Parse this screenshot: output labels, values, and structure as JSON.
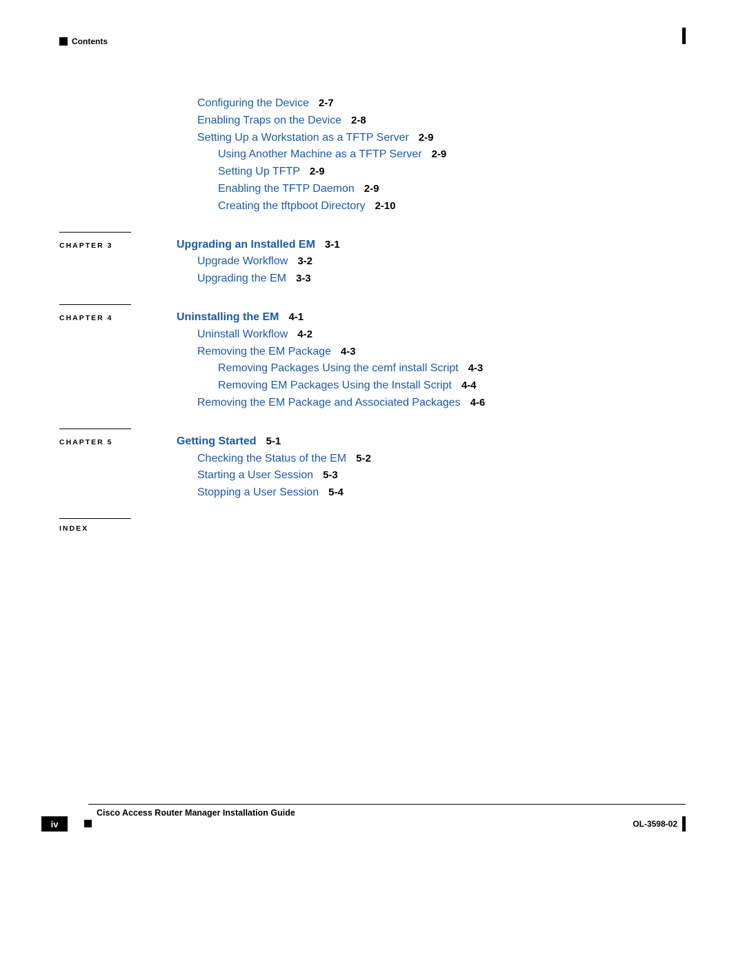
{
  "header": {
    "contents": "Contents"
  },
  "toc": {
    "preitems": [
      {
        "text": "Configuring the Device",
        "page": "2-7",
        "level": 1
      },
      {
        "text": "Enabling Traps on the Device",
        "page": "2-8",
        "level": 1
      },
      {
        "text": "Setting Up a Workstation as a TFTP Server",
        "page": "2-9",
        "level": 1
      },
      {
        "text": "Using Another Machine as a TFTP Server",
        "page": "2-9",
        "level": 2
      },
      {
        "text": "Setting Up TFTP",
        "page": "2-9",
        "level": 2
      },
      {
        "text": "Enabling the TFTP Daemon",
        "page": "2-9",
        "level": 2
      },
      {
        "text": "Creating the tftpboot Directory",
        "page": "2-10",
        "level": 2
      }
    ],
    "ch3": {
      "label": "CHAPTER 3",
      "title": "Upgrading an Installed EM",
      "title_page": "3-1",
      "items": [
        {
          "text": "Upgrade Workflow",
          "page": "3-2",
          "level": 1
        },
        {
          "text": "Upgrading the EM",
          "page": "3-3",
          "level": 1
        }
      ]
    },
    "ch4": {
      "label": "CHAPTER 4",
      "title": "Uninstalling the EM",
      "title_page": "4-1",
      "items": [
        {
          "text": "Uninstall Workflow",
          "page": "4-2",
          "level": 1
        },
        {
          "text": "Removing the EM Package",
          "page": "4-3",
          "level": 1
        },
        {
          "text": "Removing Packages Using the cemf install Script",
          "page": "4-3",
          "level": 2
        },
        {
          "text": "Removing EM Packages Using the Install Script",
          "page": "4-4",
          "level": 2
        },
        {
          "text": "Removing the EM Package and Associated Packages",
          "page": "4-6",
          "level": 1
        }
      ]
    },
    "ch5": {
      "label": "CHAPTER 5",
      "title": "Getting Started",
      "title_page": "5-1",
      "items": [
        {
          "text": "Checking the Status of the EM",
          "page": "5-2",
          "level": 1
        },
        {
          "text": "Starting a User Session",
          "page": "5-3",
          "level": 1
        },
        {
          "text": "Stopping a User Session",
          "page": "5-4",
          "level": 1
        }
      ]
    },
    "index_label": "INDEX"
  },
  "footer": {
    "title": "Cisco Access Router Manager Installation Guide",
    "page_number": "iv",
    "doc_id": "OL-3598-02"
  }
}
